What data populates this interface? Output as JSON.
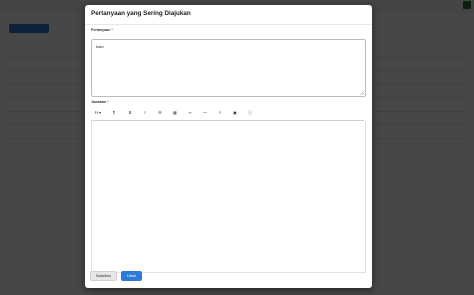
{
  "modal": {
    "title": "Pertanyaan yang Sering Diajukan",
    "question_label": "Pertanyaan",
    "required_mark": "*",
    "question_value": "halo",
    "answer_label": "Jawaban",
    "toolbar": [
      {
        "name": "heading-dropdown",
        "text": "H ▾"
      },
      {
        "name": "paragraph-icon",
        "text": "¶"
      },
      {
        "name": "bold-icon",
        "text": "B"
      },
      {
        "name": "italic-icon",
        "text": "I"
      },
      {
        "name": "list-icon",
        "text": "☰"
      },
      {
        "name": "table-icon",
        "text": "▦"
      },
      {
        "name": "link-icon",
        "text": "∞"
      },
      {
        "name": "horizontal-rule-icon",
        "text": "—"
      },
      {
        "name": "align-icon",
        "text": "≡"
      },
      {
        "name": "image-icon",
        "text": "▣"
      },
      {
        "name": "info-icon",
        "text": "ⓘ"
      }
    ],
    "cancel_label": "Batalkan",
    "save_label": "Ubah"
  },
  "colors": {
    "primary": "#2b7bd8",
    "overlay": "#000000"
  }
}
